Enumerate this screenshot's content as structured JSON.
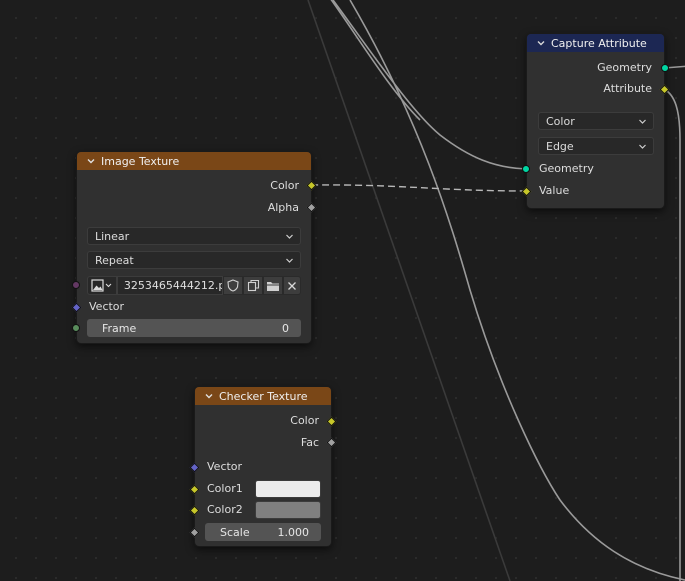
{
  "nodes": {
    "capture_attribute": {
      "title": "Capture Attribute",
      "outputs": {
        "geometry": "Geometry",
        "attribute": "Attribute"
      },
      "data_type": "Color",
      "domain": "Edge",
      "inputs": {
        "geometry": "Geometry",
        "value": "Value"
      },
      "header_color": "#1c2753"
    },
    "image_texture": {
      "title": "Image Texture",
      "outputs": {
        "color": "Color",
        "alpha": "Alpha"
      },
      "interpolation": "Linear",
      "extension": "Repeat",
      "image_name": "3253465444212.p...",
      "inputs": {
        "vector": "Vector",
        "frame_label": "Frame",
        "frame_value": "0"
      },
      "header_color": "#7a4717"
    },
    "checker_texture": {
      "title": "Checker Texture",
      "outputs": {
        "color": "Color",
        "fac": "Fac"
      },
      "inputs": {
        "vector": "Vector",
        "color1": "Color1",
        "color2": "Color2",
        "scale_label": "Scale",
        "scale_value": "1.000"
      },
      "color1_value": "#ececec",
      "color2_value": "#808080",
      "header_color": "#7a4717"
    }
  },
  "socket_colors": {
    "geometry": "#00d6a3",
    "color": "#c7c729",
    "float": "#a1a1a1",
    "vector": "#6363c7",
    "int": "#598c5c",
    "image_vector": "#633863"
  }
}
